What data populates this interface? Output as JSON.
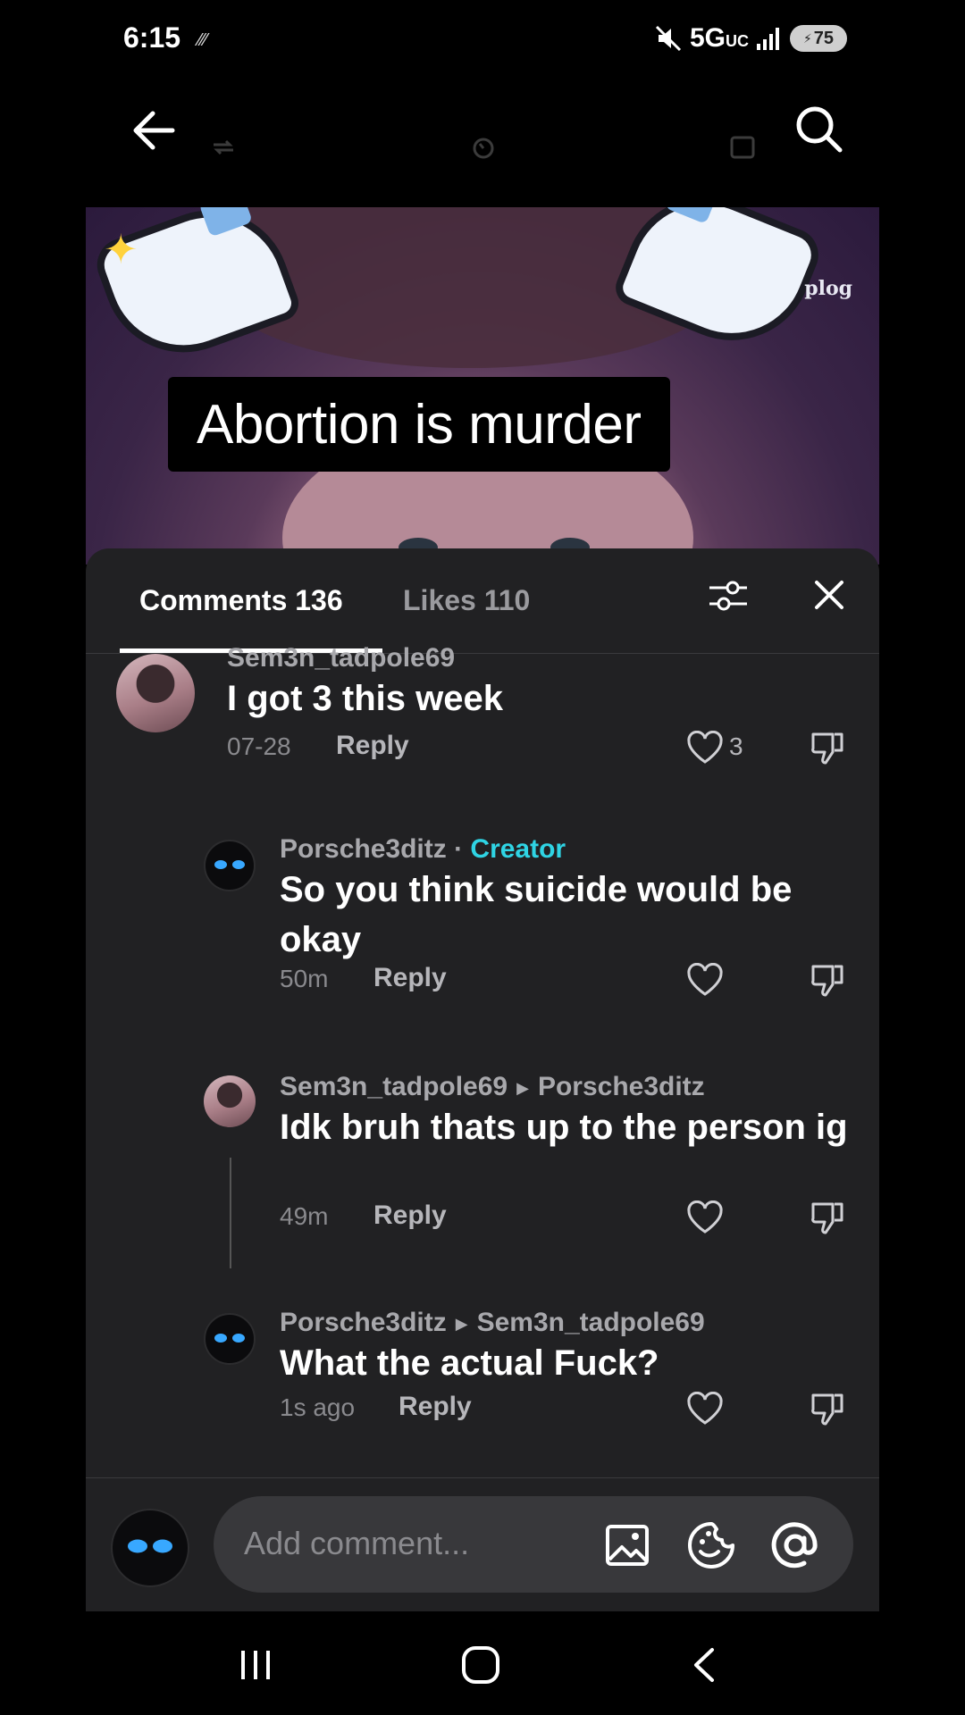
{
  "status_bar": {
    "time": "6:15",
    "network": "5G",
    "network_sub": "UC",
    "battery": "75"
  },
  "video": {
    "caption": "Abortion is murder",
    "watermark": "plog"
  },
  "tabs": {
    "comments_label": "Comments 136",
    "likes_label": "Likes 110"
  },
  "comments": [
    {
      "username": "Sem3n_tadpole69",
      "text": "I got 3 this week",
      "time": "07-28",
      "reply_label": "Reply",
      "likes": "3"
    },
    {
      "username": "Porsche3ditz",
      "badge": "Creator",
      "text": "So you think suicide would be okay",
      "time": "50m",
      "reply_label": "Reply"
    },
    {
      "username": "Sem3n_tadpole69",
      "reply_to": "Porsche3ditz",
      "text": "Idk bruh thats up to the person ig",
      "time": "49m",
      "reply_label": "Reply"
    },
    {
      "username": "Porsche3ditz",
      "reply_to": "Sem3n_tadpole69",
      "text": "What the actual Fuck?",
      "time": "1s ago",
      "reply_label": "Reply"
    }
  ],
  "input": {
    "placeholder": "Add comment..."
  },
  "colors": {
    "panel": "#212123",
    "creator_badge": "#2fd4e4",
    "avatar_eyes": "#38a8ff"
  }
}
